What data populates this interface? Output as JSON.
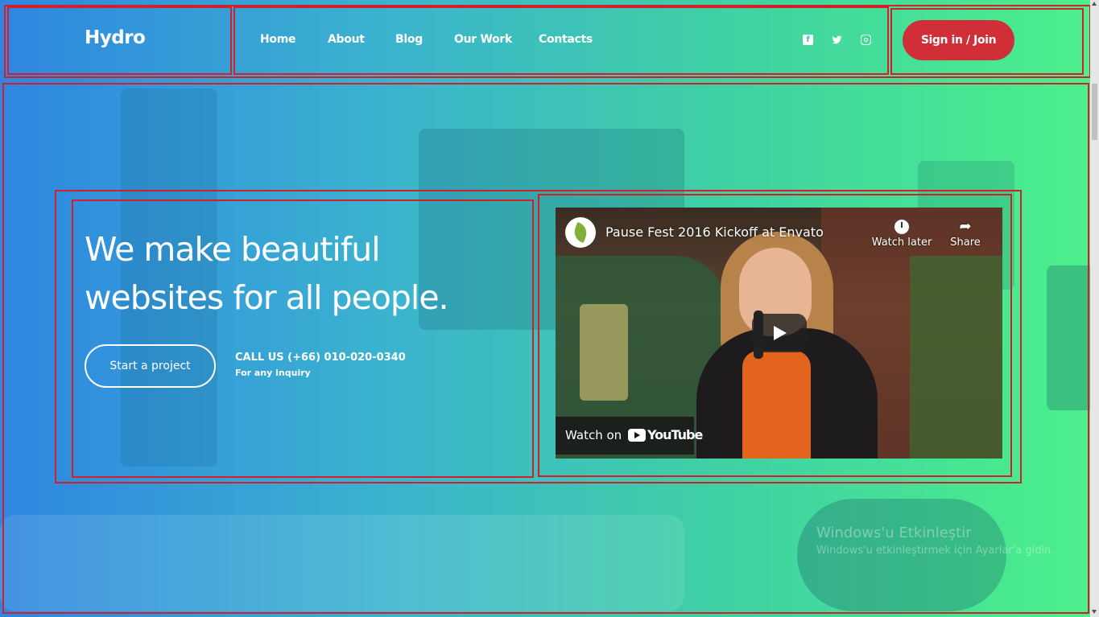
{
  "header": {
    "logo": "Hydro",
    "nav": [
      {
        "label": "Home"
      },
      {
        "label": "About"
      },
      {
        "label": "Blog"
      },
      {
        "label": "Our Work"
      },
      {
        "label": "Contacts"
      }
    ],
    "social_icons": [
      "facebook-icon",
      "twitter-icon",
      "instagram-icon"
    ],
    "signin_label": "Sign in / Join"
  },
  "hero": {
    "title_line1": "We make beautiful",
    "title_line2": "websites for all people.",
    "cta_label": "Start a project",
    "call_title": "CALL US (+66) 010-020-0340",
    "call_subtitle": "For any inquiry"
  },
  "video": {
    "title": "Pause Fest 2016 Kickoff at Envato",
    "watch_later": "Watch later",
    "share": "Share",
    "watch_on": "Watch on",
    "youtube": "YouTube"
  },
  "watermark": {
    "line1": "Windows'u Etkinleştir",
    "line2": "Windows'u etkinleştirmek için Ayarlar'a gidin."
  },
  "colors": {
    "gradient_start": "#2e86e0",
    "gradient_end": "#4cf08a",
    "signin_bg": "#d12f38",
    "highlight_box": "#d21f2b"
  }
}
